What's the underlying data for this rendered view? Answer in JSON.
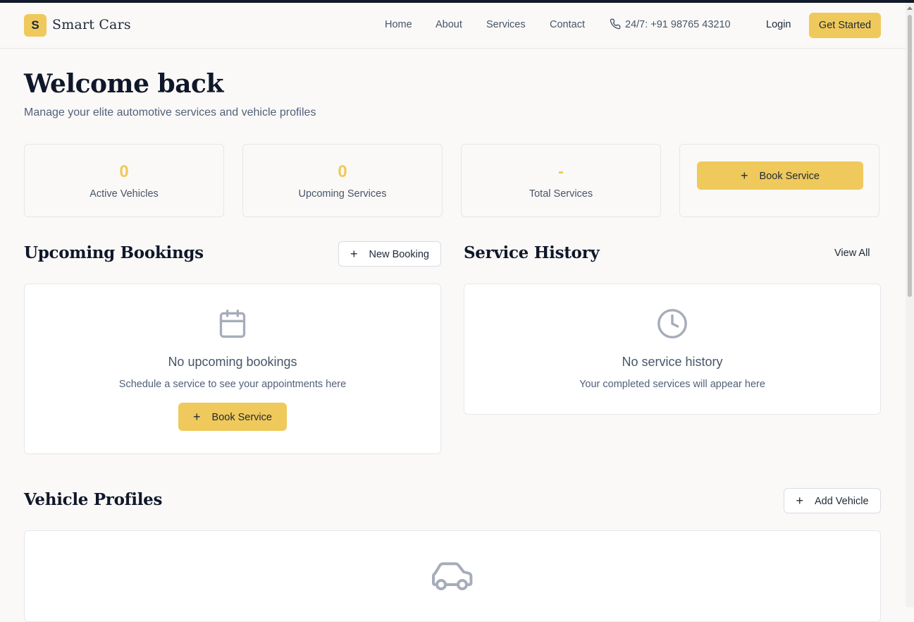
{
  "header": {
    "logo_letter": "S",
    "brand": "Smart Cars",
    "nav": [
      "Home",
      "About",
      "Services",
      "Contact"
    ],
    "phone": "24/7: +91 98765 43210",
    "login": "Login",
    "cta": "Get Started"
  },
  "welcome": {
    "title": "Welcome back",
    "subtitle": "Manage your elite automotive services and vehicle profiles"
  },
  "stats": [
    {
      "value": "0",
      "label": "Active Vehicles"
    },
    {
      "value": "0",
      "label": "Upcoming Services"
    },
    {
      "value": "-",
      "label": "Total Services"
    }
  ],
  "quick_action": {
    "label": "Book Service",
    "icon": "plus-icon"
  },
  "upcoming": {
    "title": "Upcoming Bookings",
    "new_booking": "New Booking",
    "empty_icon": "calendar-icon",
    "empty_title": "No upcoming bookings",
    "empty_subtitle": "Schedule a service to see your appointments here",
    "book_button": "Book Service"
  },
  "history": {
    "title": "Service History",
    "view_all": "View All",
    "empty_icon": "clock-icon",
    "empty_title": "No service history",
    "empty_subtitle": "Your completed services will appear here"
  },
  "vehicles": {
    "title": "Vehicle Profiles",
    "add_vehicle": "Add Vehicle",
    "empty_icon": "car-icon"
  },
  "colors": {
    "accent": "#efc95b",
    "background": "#faf9f7",
    "heading": "#0f172a",
    "muted": "#52607a",
    "icon_gray": "#a6adb9"
  }
}
